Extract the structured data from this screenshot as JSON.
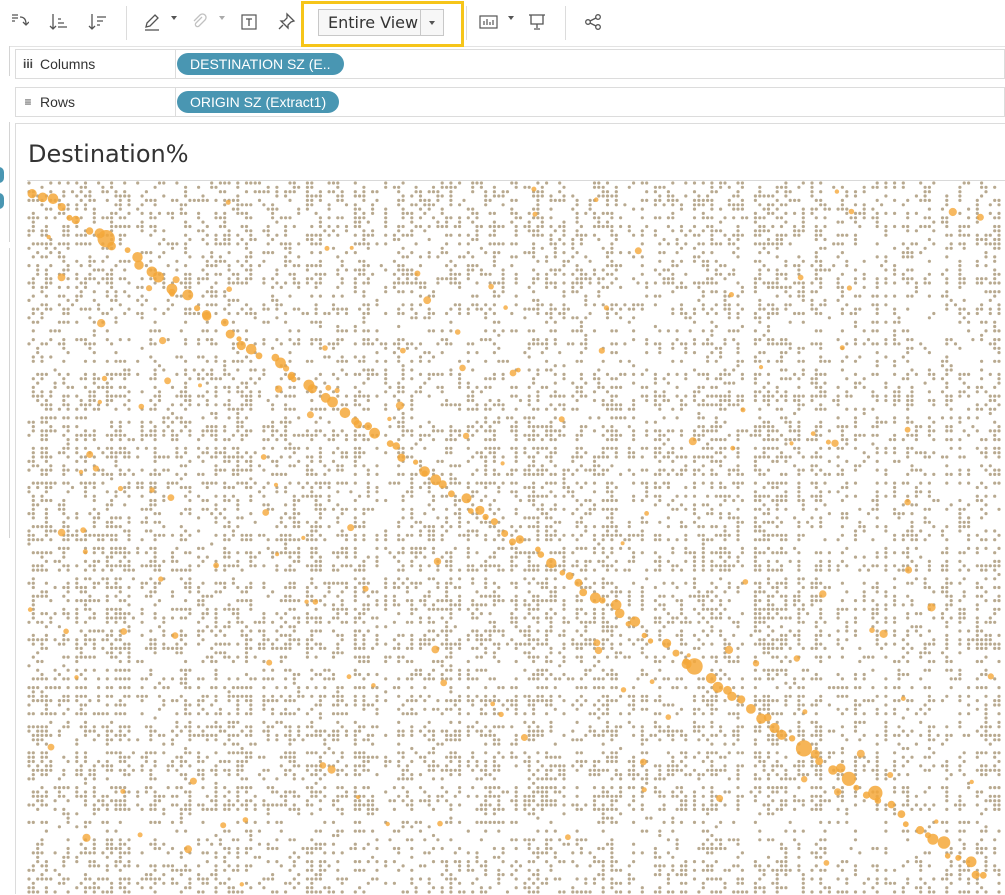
{
  "toolbar": {
    "icons": [
      "swap-axes-icon",
      "sort-ascending-icon",
      "sort-descending-icon",
      "highlight-icon",
      "clip-icon",
      "text-label-icon",
      "pin-icon",
      "show-me-icon",
      "presentation-icon",
      "share-icon"
    ],
    "fit_selector": {
      "value": "Entire View",
      "options_visible": [
        "Entire View"
      ]
    },
    "highlight_color": "#f6c519"
  },
  "shelves": {
    "columns": {
      "label": "Columns",
      "pill": "DESTINATION SZ (E.."
    },
    "rows": {
      "label": "Rows",
      "pill": "ORIGIN SZ (Extract1)"
    },
    "pill_color": "#4996b2"
  },
  "viz": {
    "title": "Destination%",
    "mark_color_small": "#b8a98f",
    "mark_color_large": "#f5a83a",
    "mark_type": "circle",
    "pattern": "origin x destination matrix with strong diagonal of larger highlighted circles"
  }
}
